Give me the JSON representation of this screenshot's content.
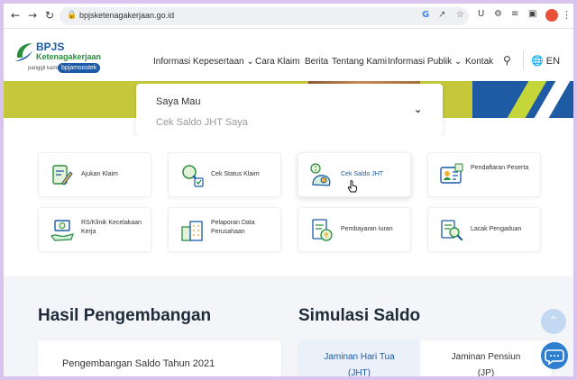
{
  "browser": {
    "back_icon": "arrow-left-icon",
    "forward_icon": "arrow-right-icon",
    "reload_icon": "reload-icon",
    "url": "bpjsketenagakerjaan.go.id"
  },
  "logo": {
    "brand": "BPJS",
    "subtitle": "Ketenagakerjaan",
    "tagline": "panggil kami",
    "nickname": "bpjamsostek"
  },
  "menu": {
    "items": [
      {
        "label": "Informasi Kepesertaan ⌄"
      },
      {
        "label": "Cara Klaim"
      },
      {
        "label": "Berita"
      },
      {
        "label": "Tentang Kami"
      },
      {
        "label": "Informasi Publik ⌄"
      },
      {
        "label": "Kontak"
      }
    ],
    "language": "EN"
  },
  "saya_mau": {
    "label": "Saya Mau",
    "selected": "Cek Saldo JHT Saya"
  },
  "services": [
    {
      "label": "Ajukan Klaim",
      "icon": "document-pen-icon"
    },
    {
      "label": "Cek Status Klaim",
      "icon": "magnifier-check-icon"
    },
    {
      "label": "Cek Saldo JHT",
      "icon": "saldo-money-icon"
    },
    {
      "label": "Pendaftaran Peserta",
      "icon": "registration-card-icon"
    },
    {
      "label": "RS/Klinik Kecelakaan Kerja",
      "icon": "hospital-hand-icon"
    },
    {
      "label": "Pelaporan Data Perusahaan",
      "icon": "company-building-icon"
    },
    {
      "label": "Pembayaran Iuran",
      "icon": "payment-document-icon"
    },
    {
      "label": "Lacak Pengaduan",
      "icon": "complaint-search-icon"
    }
  ],
  "hasil": {
    "title": "Hasil Pengembangan",
    "card_text": "Pengembangan Saldo Tahun 2021"
  },
  "simulasi": {
    "title": "Simulasi Saldo",
    "tabs": [
      {
        "label": "Jaminan Hari Tua",
        "sub": "(JHT)",
        "active": true
      },
      {
        "label": "Jaminan Pensiun",
        "sub": "(JP)",
        "active": false
      }
    ]
  },
  "colors": {
    "primary": "#1a5aa8",
    "green": "#2a8f3c",
    "hero_lime": "#c5c83a",
    "section_bg": "#f3f5f9"
  }
}
